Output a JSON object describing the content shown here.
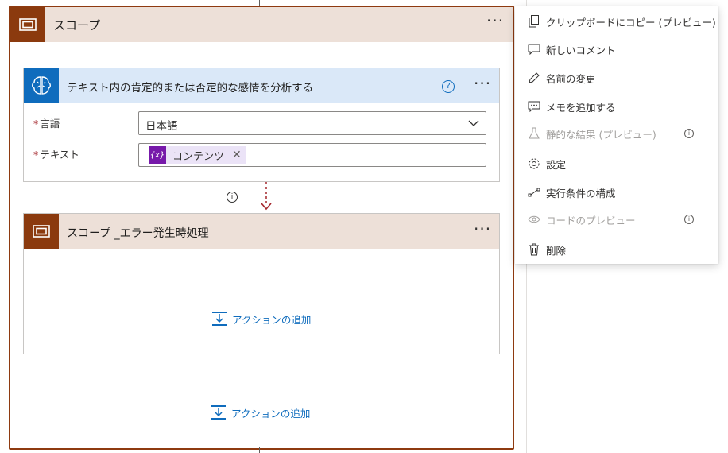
{
  "outer_scope": {
    "title": "スコープ",
    "more": "···"
  },
  "sentiment_action": {
    "title": "テキスト内の肯定的または否定的な感情を分析する",
    "help": "?",
    "more": "···",
    "language_label": "言語",
    "language_value": "日本語",
    "text_label": "テキスト",
    "text_token_icon": "{x}",
    "text_token": "コンテンツ",
    "required_mark": "*"
  },
  "connector_info": "i",
  "inner_scope": {
    "title": "スコープ _エラー発生時処理",
    "more": "···",
    "add_action": "アクションの追加"
  },
  "outer_add_action": "アクションの追加",
  "context_menu": {
    "items": [
      {
        "label": "クリップボードにコピー (プレビュー)",
        "icon": "copy-icon",
        "disabled": false
      },
      {
        "label": "新しいコメント",
        "icon": "comment-icon",
        "disabled": false
      },
      {
        "label": "名前の変更",
        "icon": "rename-pencil-icon",
        "disabled": false
      },
      {
        "label": "メモを追加する",
        "icon": "note-icon",
        "disabled": false
      },
      {
        "label": "静的な結果 (プレビュー)",
        "icon": "flask-icon",
        "disabled": true
      },
      {
        "label": "設定",
        "icon": "gear-icon",
        "disabled": false
      },
      {
        "label": "実行条件の構成",
        "icon": "run-after-icon",
        "disabled": false
      },
      {
        "label": "コードのプレビュー",
        "icon": "eye-icon",
        "disabled": true
      },
      {
        "label": "削除",
        "icon": "trash-icon",
        "disabled": false
      }
    ],
    "info_glyph": "i"
  },
  "colors": {
    "scope_accent": "#8b3a0e",
    "scope_header_bg": "#ede0d8",
    "action_accent": "#0f6cbd",
    "action_header_bg": "#dae8f8",
    "token_accent": "#7719aa",
    "connector_red": "#a4262c"
  }
}
